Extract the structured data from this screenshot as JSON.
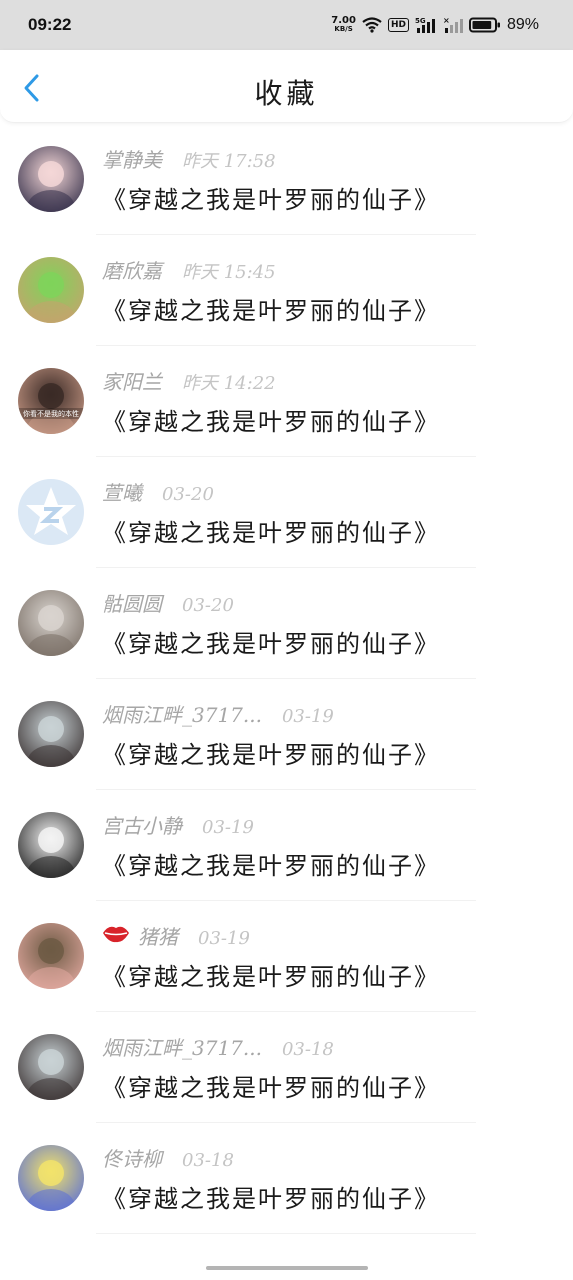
{
  "status": {
    "time": "09:22",
    "net_speed_value": "7.00",
    "net_speed_unit": "KB/S",
    "hd": "HD",
    "signal_5g": "5G",
    "battery_pct": "89%",
    "battery_level": 0.89
  },
  "header": {
    "title": "收藏"
  },
  "items": [
    {
      "name": "掌静美",
      "date": "昨天 17:58",
      "book": "《穿越之我是叶罗丽的仙子》",
      "avatar_colors": [
        "#f4d7d7",
        "#35304a"
      ]
    },
    {
      "name": "磨欣嘉",
      "date": "昨天 15:45",
      "book": "《穿越之我是叶罗丽的仙子》",
      "avatar_colors": [
        "#7fd35a",
        "#c6a36d"
      ]
    },
    {
      "name": "家阳兰",
      "date": "昨天 14:22",
      "book": "《穿越之我是叶罗丽的仙子》",
      "avatar_colors": [
        "#3a2a26",
        "#c99a86"
      ],
      "avatar_text": "你看不是我的本性"
    },
    {
      "name": "萱曦",
      "date": "03-20",
      "book": "《穿越之我是叶罗丽的仙子》",
      "avatar_colors": [
        "#dbe8f5",
        "#ffffff"
      ]
    },
    {
      "name": "骷圆圆",
      "date": "03-20",
      "book": "《穿越之我是叶罗丽的仙子》",
      "avatar_colors": [
        "#d9d4cf",
        "#7a6f66"
      ]
    },
    {
      "name": "烟雨江畔_3717...",
      "date": "03-19",
      "book": "《穿越之我是叶罗丽的仙子》",
      "avatar_colors": [
        "#c9d2d5",
        "#3b3333"
      ]
    },
    {
      "name": "宫古小静",
      "date": "03-19",
      "book": "《穿越之我是叶罗丽的仙子》",
      "avatar_colors": [
        "#f3f3f3",
        "#222222"
      ]
    },
    {
      "name": "猪猪",
      "date": "03-19",
      "book": "《穿越之我是叶罗丽的仙子》",
      "avatar_colors": [
        "#6d5a44",
        "#e2a9a0"
      ],
      "badge_icon": "lips-icon",
      "badge_color": "#d8232a"
    },
    {
      "name": "烟雨江畔_3717...",
      "date": "03-18",
      "book": "《穿越之我是叶罗丽的仙子》",
      "avatar_colors": [
        "#c9d2d5",
        "#3b3333"
      ]
    },
    {
      "name": "佟诗柳",
      "date": "03-18",
      "book": "《穿越之我是叶罗丽的仙子》",
      "avatar_colors": [
        "#f2e36b",
        "#5b6fd6"
      ]
    }
  ],
  "colors": {
    "accent": "#2e9ae6",
    "name": "#a6a6a6",
    "date": "#c4c4c4",
    "text": "#1a1a1a"
  }
}
